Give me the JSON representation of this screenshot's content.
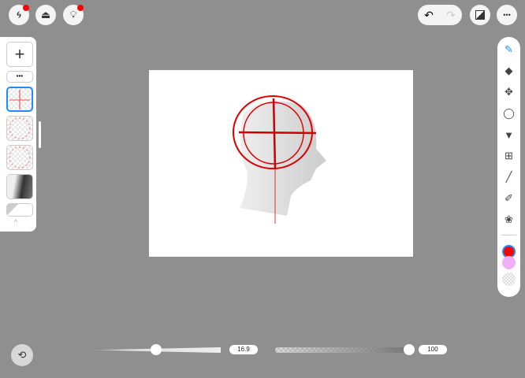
{
  "toolbar": {
    "left_icons": [
      "spiral-icon",
      "toolbox-icon",
      "lightbulb-icon"
    ],
    "right_icons": [
      "undo-icon",
      "redo-icon",
      "gallery-icon",
      "more-icon"
    ],
    "more_label": "•••"
  },
  "layers": {
    "add_label": "+",
    "menu_label": "•••",
    "items": [
      "guide-cross",
      "circle-guide",
      "circle-guide",
      "head-reference",
      "empty-layer"
    ],
    "selected_index": 0
  },
  "tools": [
    "brush",
    "eraser",
    "move",
    "lasso",
    "fill",
    "grid",
    "line",
    "eyedropper",
    "filter"
  ],
  "colors": {
    "primary": "#ff0000",
    "secondary": "#f0b0f8",
    "accent": "#1e8bff"
  },
  "brush": {
    "size_label": "16.9",
    "size_value": 16.9,
    "size_fraction": 0.52,
    "opacity_label": "100",
    "opacity_value": 100
  }
}
